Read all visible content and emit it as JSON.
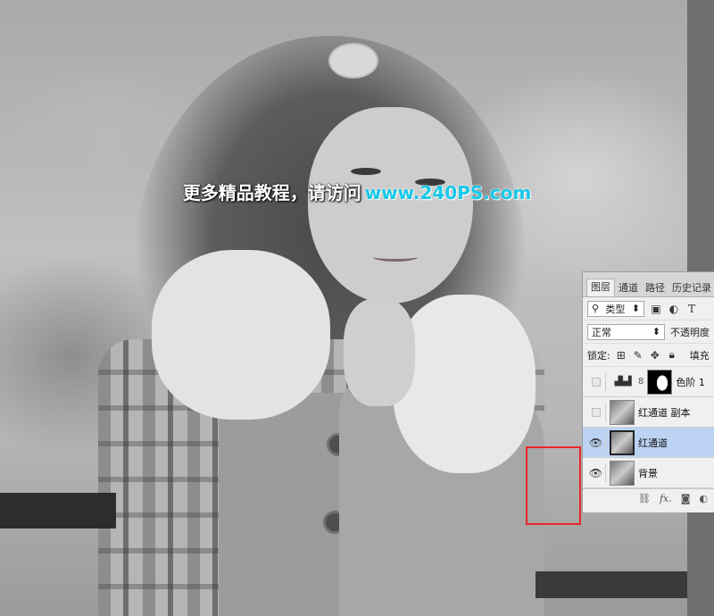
{
  "watermark": {
    "text_cn": "更多精品教程，请访问",
    "url": "www.240PS.com"
  },
  "layers_panel": {
    "tabs": [
      "图层",
      "通道",
      "路径",
      "历史记录"
    ],
    "active_tab": 0,
    "filter": {
      "label": "类型",
      "icons": [
        "image-filter-icon",
        "adjustment-filter-icon",
        "type-filter-icon"
      ]
    },
    "blend_mode": "正常",
    "opacity_label": "不透明度",
    "lock_label": "锁定:",
    "fill_label": "填充",
    "layers": [
      {
        "name": "色阶 1",
        "visible": false,
        "selected": false,
        "kind": "levels"
      },
      {
        "name": "红通道 副本",
        "visible": false,
        "selected": false,
        "kind": "image"
      },
      {
        "name": "红通道",
        "visible": true,
        "selected": true,
        "kind": "image"
      },
      {
        "name": "背景",
        "visible": true,
        "selected": false,
        "kind": "image"
      }
    ],
    "footer_icons": [
      "link-icon",
      "fx-icon",
      "mask-icon",
      "adjustment-icon"
    ],
    "footer_fx": "fx."
  },
  "colors": {
    "highlight_box": "#e8262a",
    "watermark_url": "#18c8e8",
    "selected_layer": "#bcd3f3"
  }
}
